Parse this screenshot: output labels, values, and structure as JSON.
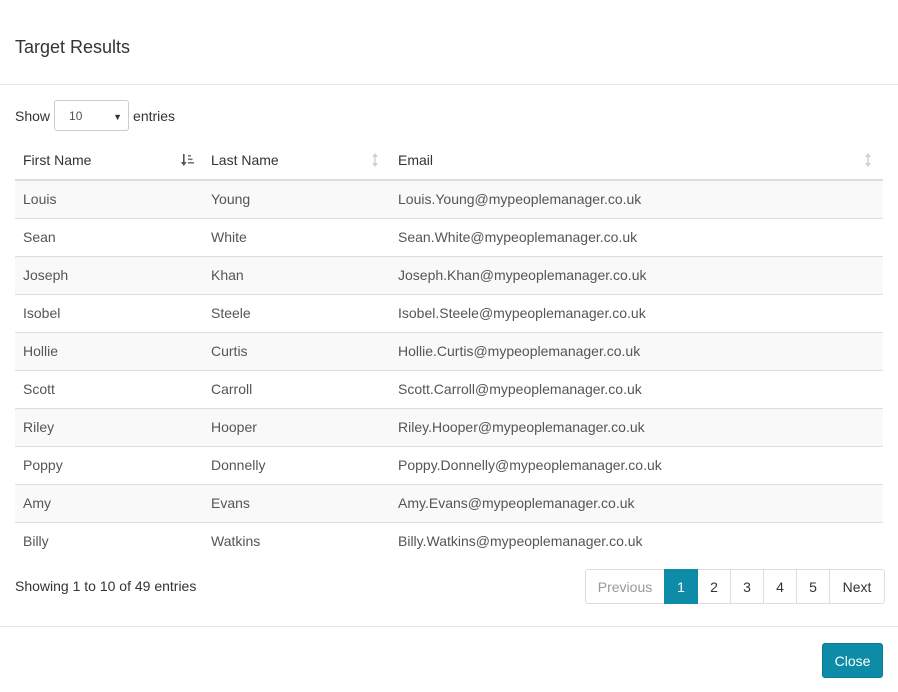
{
  "modal": {
    "title": "Target Results"
  },
  "length": {
    "show_label": "Show",
    "selected": "10",
    "entries_label": "entries"
  },
  "table": {
    "headers": {
      "first_name": "First Name",
      "last_name": "Last Name",
      "email": "Email"
    },
    "rows": [
      {
        "first": "Louis",
        "last": "Young",
        "email": "Louis.Young@mypeoplemanager.co.uk"
      },
      {
        "first": "Sean",
        "last": "White",
        "email": "Sean.White@mypeoplemanager.co.uk"
      },
      {
        "first": "Joseph",
        "last": "Khan",
        "email": "Joseph.Khan@mypeoplemanager.co.uk"
      },
      {
        "first": "Isobel",
        "last": "Steele",
        "email": "Isobel.Steele@mypeoplemanager.co.uk"
      },
      {
        "first": "Hollie",
        "last": "Curtis",
        "email": "Hollie.Curtis@mypeoplemanager.co.uk"
      },
      {
        "first": "Scott",
        "last": "Carroll",
        "email": "Scott.Carroll@mypeoplemanager.co.uk"
      },
      {
        "first": "Riley",
        "last": "Hooper",
        "email": "Riley.Hooper@mypeoplemanager.co.uk"
      },
      {
        "first": "Poppy",
        "last": "Donnelly",
        "email": "Poppy.Donnelly@mypeoplemanager.co.uk"
      },
      {
        "first": "Amy",
        "last": "Evans",
        "email": "Amy.Evans@mypeoplemanager.co.uk"
      },
      {
        "first": "Billy",
        "last": "Watkins",
        "email": "Billy.Watkins@mypeoplemanager.co.uk"
      }
    ]
  },
  "info": "Showing 1 to 10 of 49 entries",
  "pagination": {
    "previous": "Previous",
    "pages": [
      "1",
      "2",
      "3",
      "4",
      "5"
    ],
    "active_page": "1",
    "next": "Next"
  },
  "footer": {
    "close_label": "Close"
  },
  "colors": {
    "accent": "#0e8ba6",
    "stripe": "#f9f9f9",
    "border": "#dddddd"
  },
  "icons": {
    "first_name_sort": "sort-amount-asc-icon",
    "last_name_sort": "sort-both-icon",
    "email_sort": "sort-both-icon",
    "select_caret": "caret-down-icon"
  }
}
